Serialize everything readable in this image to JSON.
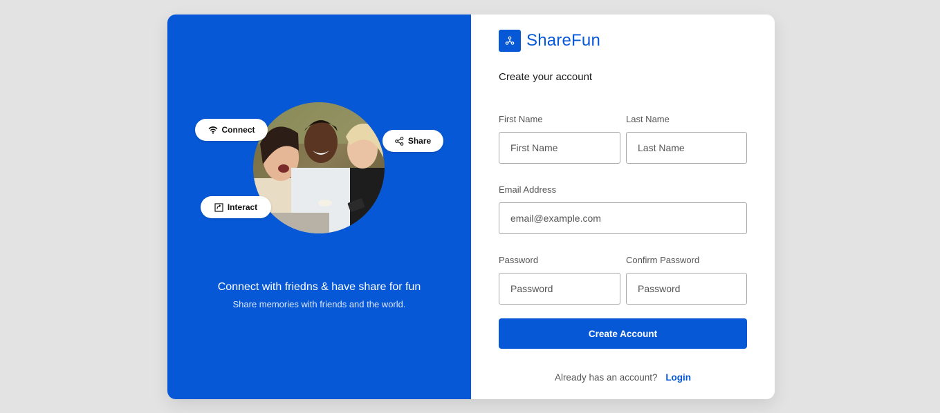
{
  "brand": {
    "name": "ShareFun",
    "icon": "share-nodes-icon",
    "accent": "#0658d6"
  },
  "hero": {
    "pills": [
      {
        "label": "Connect",
        "icon": "wifi-icon"
      },
      {
        "label": "Share",
        "icon": "share-icon"
      },
      {
        "label": "Interact",
        "icon": "interact-icon"
      }
    ],
    "title": "Connect with friedns & have share for fun",
    "subtitle": "Share memories with friends and the world."
  },
  "form": {
    "heading": "Create your account",
    "first_name": {
      "label": "First Name",
      "placeholder": "First Name",
      "value": ""
    },
    "last_name": {
      "label": "Last Name",
      "placeholder": "Last Name",
      "value": ""
    },
    "email": {
      "label": "Email Address",
      "placeholder": "email@example.com",
      "value": ""
    },
    "password": {
      "label": "Password",
      "placeholder": "Password",
      "value": ""
    },
    "confirm_password": {
      "label": "Confirm Password",
      "placeholder": "Password",
      "value": ""
    },
    "submit_label": "Create Account",
    "footer_text": "Already has an account?",
    "login_link": "Login"
  }
}
